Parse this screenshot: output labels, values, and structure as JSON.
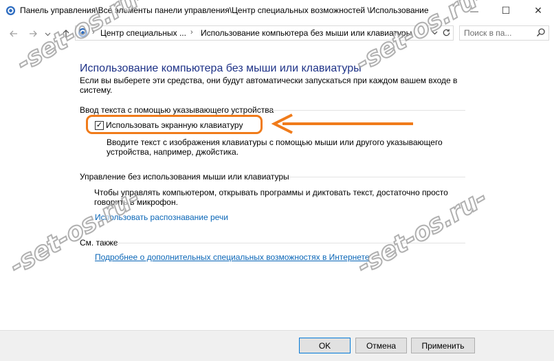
{
  "window": {
    "title": "Панель управления\\Все элементы панели управления\\Центр специальных возможностей  \\Использование",
    "minimize_glyph": "—",
    "maximize_glyph": "☐",
    "close_glyph": "✕"
  },
  "nav": {
    "back_icon": "arrow-left-icon",
    "forward_icon": "arrow-right-icon",
    "recent_icon": "chevron-down-icon",
    "up_icon": "arrow-up-icon"
  },
  "address": {
    "segment_1": "Центр специальных ...",
    "segment_2": "Использование компьютера без мыши или клавиатуры",
    "separator": "›"
  },
  "search": {
    "placeholder": "Поиск в па..."
  },
  "content": {
    "title": "Использование компьютера без мыши или клавиатуры",
    "description": "Если вы выберете эти средства, они будут автоматически запускаться при каждом вашем входе в систему.",
    "section_1": {
      "heading": "Ввод текста с помощью указывающего устройства",
      "checkbox_label": "Использовать экранную клавиатуру",
      "checkbox_checked": true,
      "checkbox_description": "Вводите текст с изображения клавиатуры с помощью мыши или другого указывающего устройства, например, джойстика."
    },
    "section_2": {
      "heading": "Управление без использования мыши или клавиатуры",
      "description": "Чтобы управлять компьютером, открывать программы и диктовать текст, достаточно просто говорить в микрофон.",
      "link": "Использовать распознавание речи"
    },
    "see_also": {
      "heading": "См. также",
      "link": "Подробнее о дополнительных специальных возможностях в Интернете"
    }
  },
  "buttons": {
    "ok": "OK",
    "cancel": "Отмена",
    "apply": "Применить"
  },
  "annotation": {
    "highlight_color": "#f07b1a"
  },
  "watermark": {
    "text": "-set-os.ru-"
  },
  "colors": {
    "title_blue": "#1e3287",
    "link_blue": "#0a66b7"
  }
}
